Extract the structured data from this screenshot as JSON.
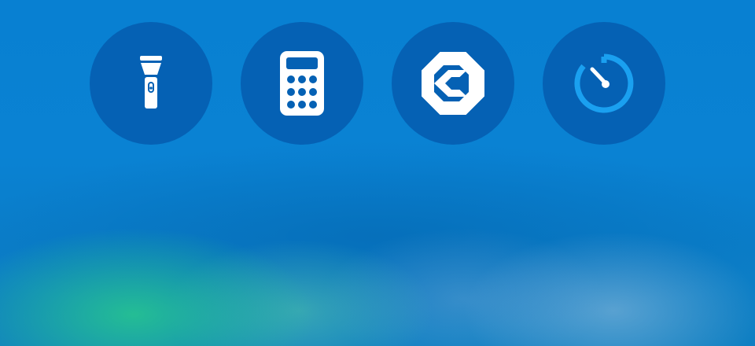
{
  "control_center": {
    "shortcuts": [
      {
        "id": "flashlight",
        "icon": "flashlight-icon",
        "active": false
      },
      {
        "id": "calculator",
        "icon": "calculator-icon",
        "active": false
      },
      {
        "id": "app-shortcut",
        "icon": "app-logo-icon",
        "active": false
      },
      {
        "id": "timer",
        "icon": "timer-icon",
        "active": false
      }
    ]
  },
  "colors": {
    "background": "#0a7fd0",
    "button_fill": "#0561b4",
    "icon_white": "#ffffff",
    "timer_accent": "#1aa0f0"
  }
}
